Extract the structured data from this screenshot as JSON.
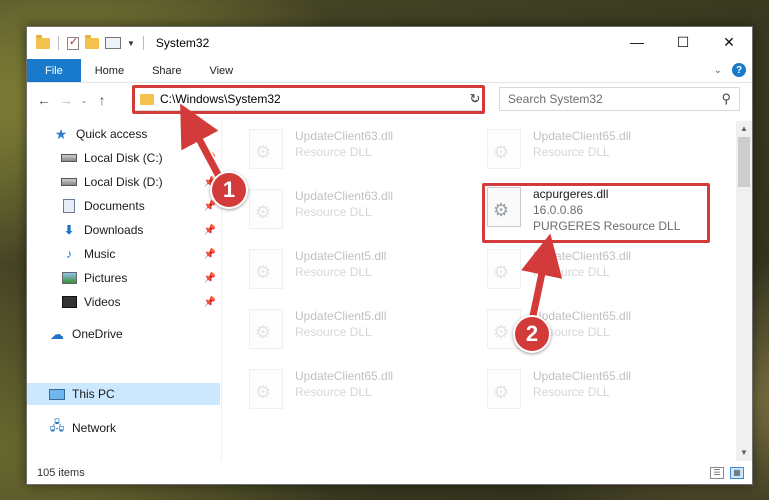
{
  "window": {
    "title": "System32",
    "controls": {
      "minimize": "—",
      "maximize": "☐",
      "close": "✕"
    }
  },
  "ribbon": {
    "tabs": [
      "File",
      "Home",
      "Share",
      "View"
    ],
    "help": "?"
  },
  "nav": {
    "address": "C:\\Windows\\System32",
    "search_placeholder": "Search System32"
  },
  "sidebar": {
    "items": [
      {
        "label": "Quick access",
        "icon": "star-icon",
        "pinned": false
      },
      {
        "label": "Local Disk (C:)",
        "icon": "disk-icon",
        "pinned": true
      },
      {
        "label": "Local Disk (D:)",
        "icon": "disk-icon",
        "pinned": true
      },
      {
        "label": "Documents",
        "icon": "documents-icon",
        "pinned": true
      },
      {
        "label": "Downloads",
        "icon": "downloads-icon",
        "pinned": true
      },
      {
        "label": "Music",
        "icon": "music-icon",
        "pinned": true
      },
      {
        "label": "Pictures",
        "icon": "pictures-icon",
        "pinned": true
      },
      {
        "label": "Videos",
        "icon": "videos-icon",
        "pinned": true
      },
      {
        "label": "OneDrive",
        "icon": "onedrive-icon",
        "pinned": false
      },
      {
        "label": "This PC",
        "icon": "this-pc-icon",
        "pinned": false,
        "selected": true
      },
      {
        "label": "Network",
        "icon": "network-icon",
        "pinned": false
      }
    ]
  },
  "files": [
    {
      "name": "UpdateClient63.dll",
      "type": "Resource DLL"
    },
    {
      "name": "UpdateClient65.dll",
      "type": "Resource DLL"
    },
    {
      "name": "UpdateClient63.dll",
      "type": "Resource DLL"
    },
    {
      "name": "acpurgeres.dll",
      "version": "16.0.0.86",
      "type": "PURGERES Resource DLL"
    },
    {
      "name": "UpdateClient5.dll",
      "type": "Resource DLL"
    },
    {
      "name": "UpdateClient63.dll",
      "type": "Resource DLL"
    },
    {
      "name": "UpdateClient5.dll",
      "type": "Resource DLL"
    },
    {
      "name": "UpdateClient65.dll",
      "type": "Resource DLL"
    },
    {
      "name": "UpdateClient65.dll",
      "type": "Resource DLL"
    },
    {
      "name": "UpdateClient65.dll",
      "type": "Resource DLL"
    }
  ],
  "status": {
    "item_count": "105 items"
  },
  "annotations": {
    "step1": "1",
    "step2": "2"
  },
  "colors": {
    "accent": "#1979ca",
    "highlight": "#d33b3b",
    "selected": "#cce8ff"
  }
}
